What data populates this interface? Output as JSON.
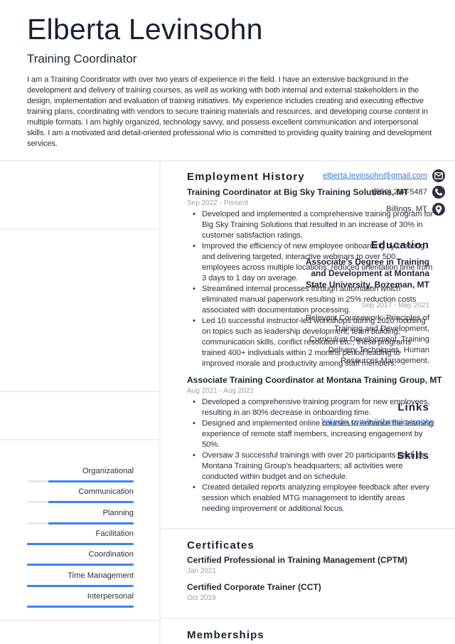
{
  "header": {
    "name": "Elberta Levinsohn",
    "title": "Training Coordinator",
    "summary": "I am a Training Coordinator with over two years of experience in the field. I have an extensive background in the development and delivery of training courses, as well as working with both internal and external stakeholders in the design, implementation and evaluation of training initiatives. My experience includes creating and executing effective training plans, coordinating with vendors to secure training materials and resources, and developing course content in multiple formats. I am highly organized, technology savvy, and possess excellent communication and interpersonal skills. I am a motivated and detail-oriented professional who is committed to providing quality training and development services."
  },
  "contact": {
    "email": "elberta.levinsohn@gmail.com",
    "phone": "(950) 234-5487",
    "location": "Billings, MT",
    "icons": [
      "envelope-icon",
      "phone-icon",
      "map-pin-icon"
    ],
    "icon_color": "#2d3340"
  },
  "education": {
    "heading": "Education",
    "degree": "Associate's Degree in Training and Development at Montana State University, Bozeman, MT",
    "dates": "Sep 2017 - May 2021",
    "description": "Relevant Coursework: Principles of Training and Development, Curriculum Development, Training Delivery Techniques, Human Resources Management."
  },
  "links": {
    "heading": "Links",
    "items": [
      {
        "label": "linkedin.com/in/elbertalevinsohn"
      }
    ]
  },
  "skills": {
    "heading": "Skills",
    "bar_color": "#3b82f6",
    "track_color": "#e5e7eb",
    "items": [
      {
        "label": "Organizational",
        "level": 0.8
      },
      {
        "label": "Communication",
        "level": 0.8
      },
      {
        "label": "Planning",
        "level": 0.8
      },
      {
        "label": "Facilitation",
        "level": 1.0
      },
      {
        "label": "Coordination",
        "level": 1.0
      },
      {
        "label": "Time Management",
        "level": 1.0
      },
      {
        "label": "Interpersonal",
        "level": 1.0
      }
    ]
  },
  "employment": {
    "heading": "Employment History",
    "jobs": [
      {
        "title": "Training Coordinator at Big Sky Training Solutions, MT",
        "dates": "Sep 2022 - Present",
        "bullets": [
          "Developed and implemented a comprehensive training program for Big Sky Training Solutions that resulted in an increase of 30% in customer satisfaction ratings.",
          "Improved the efficiency of new employee onboarding by creating and delivering targeted, interactive webinars to over 500 employees across multiple locations; reduced orientation time from 3 days to 1 day on average.",
          "Streamlined internal processes through automation which eliminated manual paperwork resulting in 25% reduction costs associated with documentation processing.",
          "Led 10 successful instructor-led workshops during 2020 focusing on topics such as leadership development, team building, communication skills, conflict resolution etc.; these programs trained 400+ individuals within 2 months period leading to improved morale and productivity among staff members."
        ]
      },
      {
        "title": "Associate Training Coordinator at Montana Training Group, MT",
        "dates": "Aug 2021 - Aug 2022",
        "bullets": [
          "Developed a comprehensive training program for new employees, resulting in an 80% decrease in onboarding time.",
          "Designed and implemented online courses to enhance the learning experience of remote staff members, increasing engagement by 50%.",
          "Oversaw 3 successful trainings with over 20 participants each at Montana Training Group’s headquarters; all activities were conducted within budget and on schedule.",
          "Created detailed reports analyzing employee feedback after every session which enabled MTG management to identify areas needing improvement or additional focus."
        ]
      }
    ]
  },
  "certificates": {
    "heading": "Certificates",
    "items": [
      {
        "name": "Certified Professional in Training Management (CPTM)",
        "date": "Jan 2021"
      },
      {
        "name": "Certified Corporate Trainer (CCT)",
        "date": "Oct 2019"
      }
    ]
  },
  "memberships": {
    "heading": "Memberships"
  }
}
